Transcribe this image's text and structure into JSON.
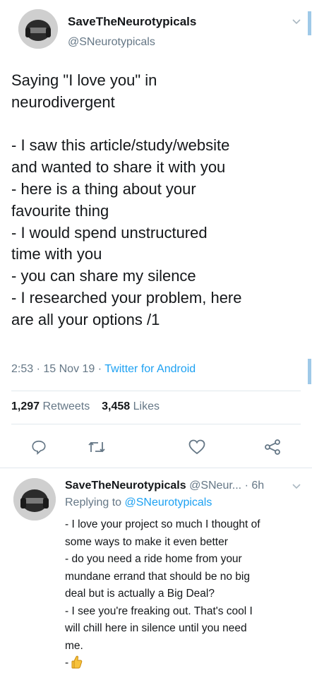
{
  "main_tweet": {
    "author_name": "SaveTheNeurotypicals",
    "author_handle": "@SNeurotypicals",
    "text": "Saying \"I love you\" in\nneurodivergent\n\n- I saw this article/study/website\nand wanted to share it with you\n- here is a thing about your\nfavourite thing\n- I would spend unstructured\ntime with you\n- you can share my silence\n- I researched your problem, here\nare all your options /1",
    "time": "2:53",
    "date": "15 Nov 19",
    "source": "Twitter for Android",
    "retweets_count": "1,297",
    "retweets_label": "Retweets",
    "likes_count": "3,458",
    "likes_label": "Likes"
  },
  "reply_tweet": {
    "author_name": "SaveTheNeurotypicals",
    "author_handle": "@SNeur...",
    "age": "6h",
    "replying_label": "Replying to",
    "replying_handle": "@SNeurotypicals",
    "text": "- I love your project so much I thought of\nsome ways to make it even better\n- do you need a ride home from your\nmundane errand that should be no big\ndeal but is actually a Big Deal?\n- I see you're freaking out. That's cool I\nwill chill here in silence until you need\nme.",
    "last_line_prefix": "-"
  },
  "icons": [
    "avatar",
    "chevron-down-icon",
    "reply-icon",
    "retweet-icon",
    "like-icon",
    "share-icon",
    "thumbs-up-emoji"
  ],
  "colors": {
    "link": "#1da1f2",
    "muted": "#657786",
    "text": "#14171a",
    "divider": "#e1e8ed"
  }
}
